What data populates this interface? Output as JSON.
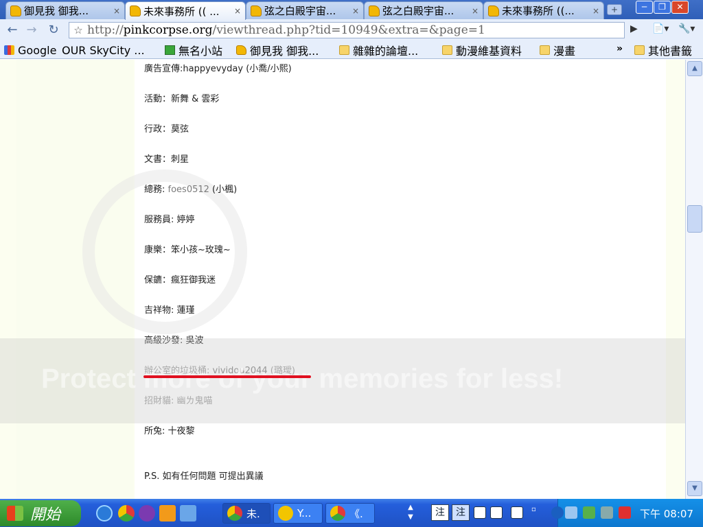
{
  "tabs": [
    {
      "label": "御見我 御我...",
      "close": "×"
    },
    {
      "label": "未來事務所 ((  ...",
      "close": "×"
    },
    {
      "label": "弦之白殿宇宙...",
      "close": "×"
    },
    {
      "label": "弦之白殿宇宙...",
      "close": "×"
    },
    {
      "label": "未來事務所 ((...",
      "close": "×"
    }
  ],
  "active_tab_index": 1,
  "window_controls": {
    "minimize": "─",
    "maximize": "❐",
    "close": "✕"
  },
  "toolbar": {
    "back": "←",
    "forward": "→",
    "reload": "↻",
    "star": "☆",
    "url_prefix": "http://",
    "url_domain": "pinkcorpse.org",
    "url_path": "/viewthread.php?tid=10949&extra=&page=1",
    "go": "▶",
    "page_menu": "📄▾",
    "wrench": "🔧▾"
  },
  "bookmarks": [
    {
      "label": "Google",
      "icon": "google-icon"
    },
    {
      "label": "OUR SkyCity ...",
      "icon": "page-icon"
    },
    {
      "label": "無名小站",
      "icon": "wretch-icon"
    },
    {
      "label": "御見我 御我...",
      "icon": "favicon"
    },
    {
      "label": "雜雜的論壇...",
      "icon": "folder-icon"
    },
    {
      "label": "動漫維基資料",
      "icon": "folder-icon"
    },
    {
      "label": "漫畫",
      "icon": "folder-icon"
    },
    {
      "label": "其他書籤",
      "icon": "folder-icon"
    }
  ],
  "bookmarks_more": "»",
  "post": {
    "lines": [
      {
        "text": "廣告宣傳:happyevyday (小喬/小熙)"
      },
      {
        "text": "活動：新舞 & 雲彩"
      },
      {
        "text": "行政：莫弦"
      },
      {
        "text": "文書：刺星"
      },
      {
        "label": "總務: ",
        "user": "foes0512",
        "suffix": " (小楓)"
      },
      {
        "text": "服務員: 婷婷"
      },
      {
        "text": "康樂：笨小孩~玫瑰~"
      },
      {
        "text": "保鑣：瘋狂御我迷"
      },
      {
        "text": "吉祥物: 蓮瑾"
      },
      {
        "text": "高級沙發: 吳波"
      },
      {
        "label": "辦公室的垃圾桶: ",
        "user": "vividou2044",
        "suffix": " (璐璦)"
      },
      {
        "text": "招財貓: 幽ㄌ鬼喵"
      },
      {
        "text": "所兔: 十夜黎"
      },
      {
        "text": "P.S. 如有任何問題 可提出異議"
      }
    ]
  },
  "watermark": "Protect more of your memories for less!",
  "scrollbar": {
    "up": "▲",
    "down": "▼"
  },
  "taskbar": {
    "start_label": "開始",
    "buttons": [
      {
        "label": "未."
      },
      {
        "label": "Y..."
      },
      {
        "label": "《."
      }
    ],
    "ime_char": "注",
    "ime_char2": "注",
    "clock": "下午 08:07"
  },
  "colors": {
    "title_bar": "#2f5fb8",
    "page_bg": "#fcfef0",
    "underline": "#e01020",
    "taskbar": "#245edb",
    "start": "#3a9a36"
  }
}
